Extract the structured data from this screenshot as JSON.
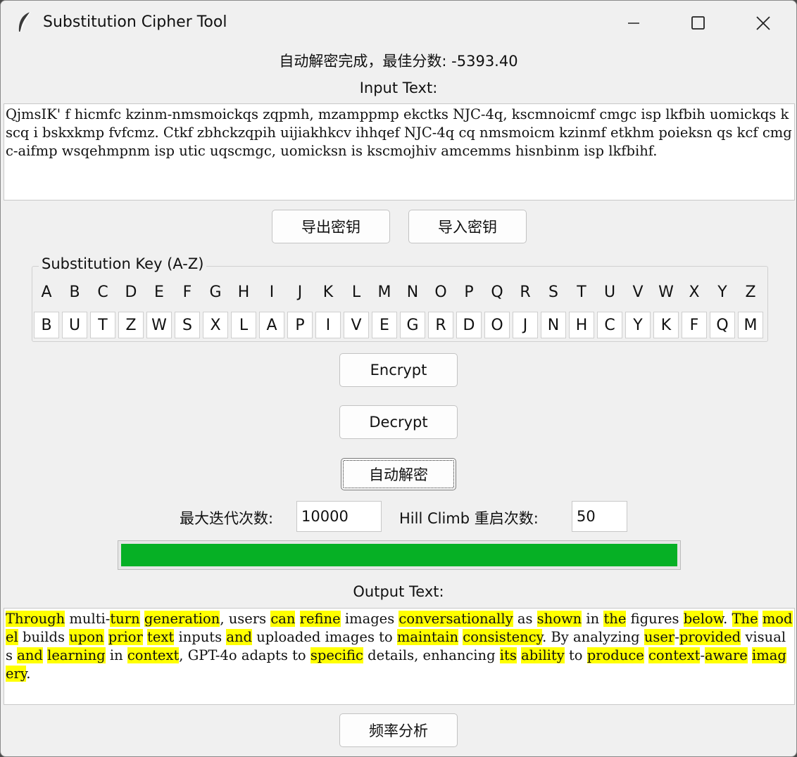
{
  "window": {
    "title": "Substitution Cipher Tool"
  },
  "status": "自动解密完成，最佳分数: -5393.40",
  "input_label": "Input Text:",
  "input_text": "QjmsIK' f hicmfc kzinm-nmsmoickqs zqpmh, mzamppmp ekctks NJC-4q, kscmnoicmf cmgc isp lkfbih uomickqs kscq i bskxkmp fvfcmz. Ctkf zbhckzqpih uijiakhkcv ihhqef NJC-4q cq nmsmoicm kzinmf etkhm poieksn qs kcf cmgc-aifmp wsqehmpnm isp utic uqscmgc, uomicksn is kscmojhiv amcemms hisnbinm isp lkfbihf.",
  "key_buttons": {
    "export": "导出密钥",
    "import": "导入密钥"
  },
  "key_frame_title": "Substitution Key (A-Z)",
  "alphabet": [
    "A",
    "B",
    "C",
    "D",
    "E",
    "F",
    "G",
    "H",
    "I",
    "J",
    "K",
    "L",
    "M",
    "N",
    "O",
    "P",
    "Q",
    "R",
    "S",
    "T",
    "U",
    "V",
    "W",
    "X",
    "Y",
    "Z"
  ],
  "cipher_key": [
    "B",
    "U",
    "T",
    "Z",
    "W",
    "S",
    "X",
    "L",
    "A",
    "P",
    "I",
    "V",
    "E",
    "G",
    "R",
    "D",
    "O",
    "J",
    "N",
    "H",
    "C",
    "Y",
    "K",
    "F",
    "Q",
    "M"
  ],
  "buttons": {
    "encrypt": "Encrypt",
    "decrypt": "Decrypt",
    "auto_decrypt": "自动解密",
    "freq": "频率分析"
  },
  "params": {
    "max_iter_label": "最大迭代次数:",
    "max_iter_value": "10000",
    "restarts_label": "Hill Climb 重启次数:",
    "restarts_value": "50"
  },
  "progress": 1.0,
  "output_label": "Output Text:",
  "output_segments": [
    {
      "t": "Through",
      "h": true
    },
    {
      "t": " multi-"
    },
    {
      "t": "turn",
      "h": true
    },
    {
      "t": " "
    },
    {
      "t": "generation",
      "h": true
    },
    {
      "t": ", users "
    },
    {
      "t": "can",
      "h": true
    },
    {
      "t": " "
    },
    {
      "t": "refine",
      "h": true
    },
    {
      "t": " images "
    },
    {
      "t": "conversationally",
      "h": true
    },
    {
      "t": " as "
    },
    {
      "t": "shown",
      "h": true
    },
    {
      "t": " in "
    },
    {
      "t": "the",
      "h": true
    },
    {
      "t": " figures "
    },
    {
      "t": "below",
      "h": true
    },
    {
      "t": ". "
    },
    {
      "t": "The",
      "h": true
    },
    {
      "t": " "
    },
    {
      "t": "model",
      "h": true
    },
    {
      "t": " builds "
    },
    {
      "t": "upon",
      "h": true
    },
    {
      "t": " "
    },
    {
      "t": "prior",
      "h": true
    },
    {
      "t": " "
    },
    {
      "t": "text",
      "h": true
    },
    {
      "t": " inputs "
    },
    {
      "t": "and",
      "h": true
    },
    {
      "t": " uploaded images to "
    },
    {
      "t": "maintain",
      "h": true
    },
    {
      "t": " "
    },
    {
      "t": "consistency",
      "h": true
    },
    {
      "t": ". By analyzing "
    },
    {
      "t": "user",
      "h": true
    },
    {
      "t": "-"
    },
    {
      "t": "provided",
      "h": true
    },
    {
      "t": " visuals "
    },
    {
      "t": "and",
      "h": true
    },
    {
      "t": " "
    },
    {
      "t": "learning",
      "h": true
    },
    {
      "t": " in "
    },
    {
      "t": "context",
      "h": true
    },
    {
      "t": ", GPT-4o adapts to "
    },
    {
      "t": "specific",
      "h": true
    },
    {
      "t": " details, enhancing "
    },
    {
      "t": "its",
      "h": true
    },
    {
      "t": " "
    },
    {
      "t": "ability",
      "h": true
    },
    {
      "t": " to "
    },
    {
      "t": "produce",
      "h": true
    },
    {
      "t": " "
    },
    {
      "t": "context",
      "h": true
    },
    {
      "t": "-"
    },
    {
      "t": "aware",
      "h": true
    },
    {
      "t": " "
    },
    {
      "t": "imagery",
      "h": true
    },
    {
      "t": "."
    }
  ],
  "colors": {
    "progress_fill": "#06b025",
    "highlight": "#ffff00",
    "window_bg": "#f0f0f0"
  },
  "icons": {
    "app": "feather-icon",
    "minimize": "minimize-icon",
    "maximize": "maximize-icon",
    "close": "close-icon"
  }
}
